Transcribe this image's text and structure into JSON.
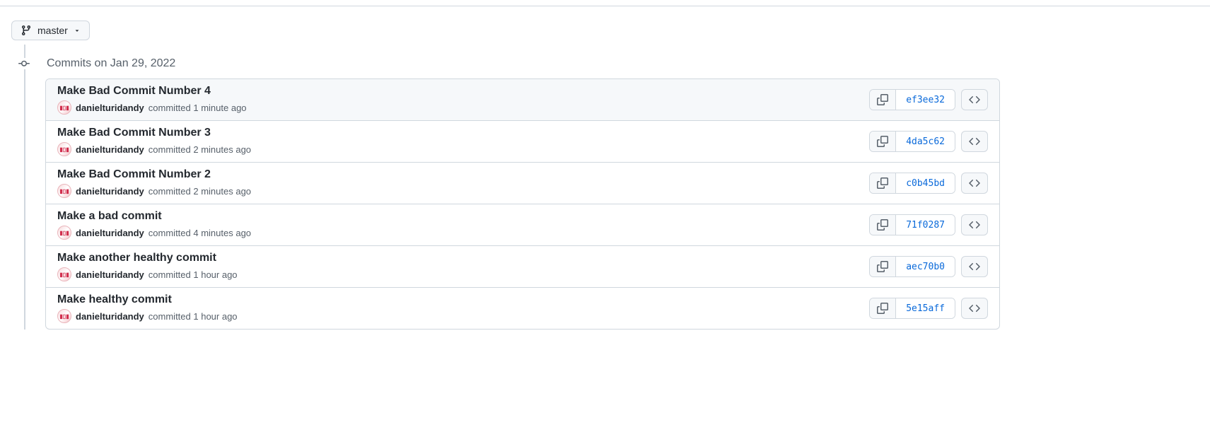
{
  "branch": {
    "name": "master"
  },
  "date_group": {
    "label": "Commits on Jan 29, 2022"
  },
  "commits": [
    {
      "title": "Make Bad Commit Number 4",
      "author": "danielturidandy",
      "meta": "committed 1 minute ago",
      "sha": "ef3ee32",
      "highlighted": true
    },
    {
      "title": "Make Bad Commit Number 3",
      "author": "danielturidandy",
      "meta": "committed 2 minutes ago",
      "sha": "4da5c62",
      "highlighted": false
    },
    {
      "title": "Make Bad Commit Number 2",
      "author": "danielturidandy",
      "meta": "committed 2 minutes ago",
      "sha": "c0b45bd",
      "highlighted": false
    },
    {
      "title": "Make a bad commit",
      "author": "danielturidandy",
      "meta": "committed 4 minutes ago",
      "sha": "71f0287",
      "highlighted": false
    },
    {
      "title": "Make another healthy commit",
      "author": "danielturidandy",
      "meta": "committed 1 hour ago",
      "sha": "aec70b0",
      "highlighted": false
    },
    {
      "title": "Make healthy commit",
      "author": "danielturidandy",
      "meta": "committed 1 hour ago",
      "sha": "5e15aff",
      "highlighted": false
    }
  ]
}
